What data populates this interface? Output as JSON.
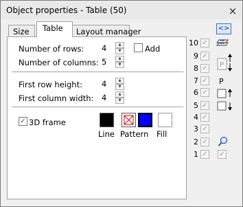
{
  "window": {
    "title": "Object properties - Table (50)",
    "close_symbol": "×"
  },
  "tabs": [
    {
      "label": "Size",
      "active": false
    },
    {
      "label": "Table",
      "active": true
    },
    {
      "label": "Layout manager",
      "active": false
    }
  ],
  "table_tab": {
    "rows_label": "Number of rows:",
    "rows_value": "4",
    "add_label": "Add",
    "add_checked": false,
    "cols_label": "Number of columns:",
    "cols_value": "5",
    "row_height_label": "First row height:",
    "row_height_value": "4",
    "col_width_label": "First column width:",
    "col_width_value": "4",
    "frame3d_label": "3D frame",
    "frame3d_checked": true,
    "swatches": [
      {
        "label": "Line",
        "color": "#000000"
      },
      {
        "label": "Pattern",
        "color": "#ffffff",
        "icon": "no-pattern-icon"
      },
      {
        "label": "Fill",
        "color": "#ffffff"
      }
    ],
    "pattern_fg_color": "#0000ff"
  },
  "right_panel": {
    "top_icon": "code-brackets-icon",
    "top_icon_text": "<>",
    "levels": [
      {
        "num": "10",
        "checked": true
      },
      {
        "num": "9",
        "checked": true
      },
      {
        "num": "8",
        "checked": true
      },
      {
        "num": "7",
        "checked": true
      },
      {
        "num": "6",
        "checked": true
      },
      {
        "num": "5",
        "checked": true
      },
      {
        "num": "4",
        "checked": true
      },
      {
        "num": "3",
        "checked": true
      },
      {
        "num": "2",
        "checked": true
      },
      {
        "num": "1",
        "checked": true
      }
    ],
    "p_label_1": "P",
    "p_label_2": "P",
    "bottom_check": true
  }
}
